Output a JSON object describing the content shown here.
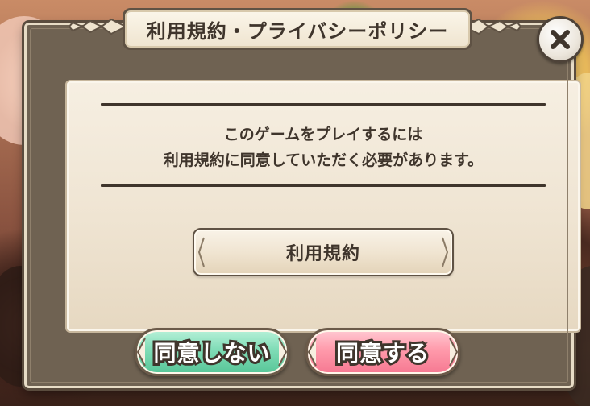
{
  "dialog": {
    "title": "利用規約・プライバシーポリシー",
    "message_lines": [
      "このゲームをプレイするには",
      "利用規約に同意していただく必要があります。"
    ],
    "terms_button_label": "利用規約",
    "disagree_button_label": "同意しない",
    "agree_button_label": "同意する",
    "close_icon": "close-x-icon"
  },
  "colors": {
    "frame": "#6f6252",
    "panel": "#f3ead9",
    "text": "#3f352c",
    "disagree": "#7fdcb6",
    "agree": "#ff9aab"
  }
}
